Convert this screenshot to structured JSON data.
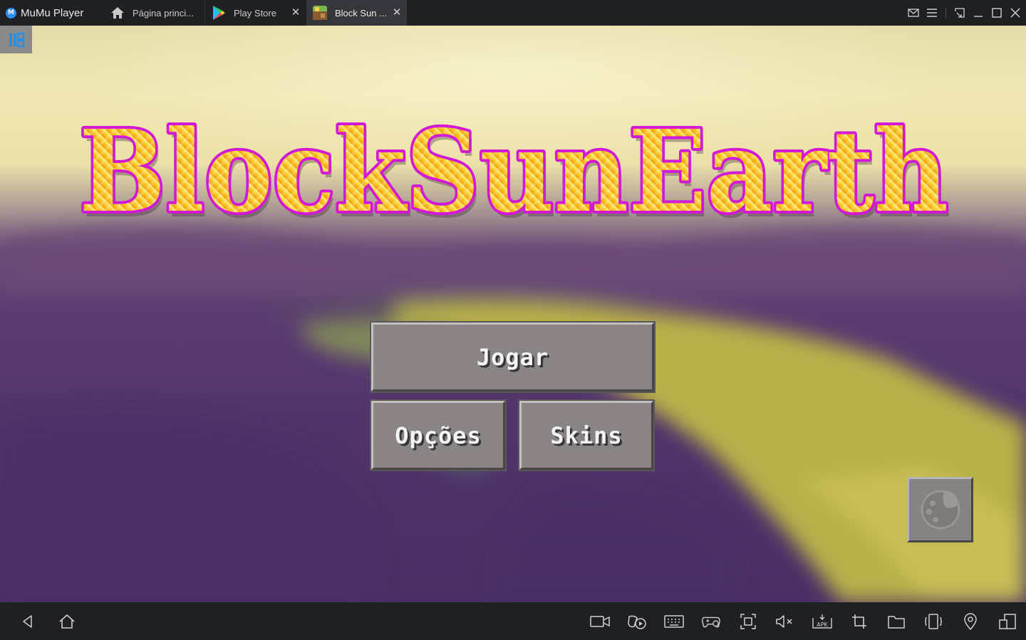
{
  "app": {
    "name": "MuMu Player",
    "logo_letter": "M"
  },
  "tabs": [
    {
      "label": "Página princi...",
      "icon": "home-icon",
      "active": false
    },
    {
      "label": "Play Store",
      "icon": "play-store-icon",
      "active": false
    },
    {
      "label": "Block Sun ...",
      "icon": "block-sun-earth-app-icon",
      "active": true
    }
  ],
  "window_controls": [
    "mail-icon",
    "menu-icon",
    "screenshot-icon",
    "minimize-icon",
    "maximize-icon",
    "close-icon"
  ],
  "game": {
    "title": "BlockSunEarth",
    "buttons": {
      "play": "Jogar",
      "options": "Opções",
      "skins": "Skins"
    },
    "extra_button_icon": "palette-icon"
  },
  "nav_left": [
    "back-icon",
    "home-icon"
  ],
  "nav_right": [
    "video-record-icon",
    "gamepad-play-icon",
    "keyboard-icon",
    "gamepad-settings-icon",
    "fullscreen-capture-icon",
    "volume-mute-icon",
    "apk-install-icon",
    "crop-icon",
    "folder-icon",
    "rotate-icon",
    "location-icon",
    "multi-window-icon"
  ],
  "nav_apk_label": "APK",
  "colors": {
    "titlebar": "#1f2024",
    "active_tab": "#35363b",
    "button_face": "#8b8485",
    "title_fill": "#f7c21e",
    "title_outline": "#d21ad6"
  }
}
